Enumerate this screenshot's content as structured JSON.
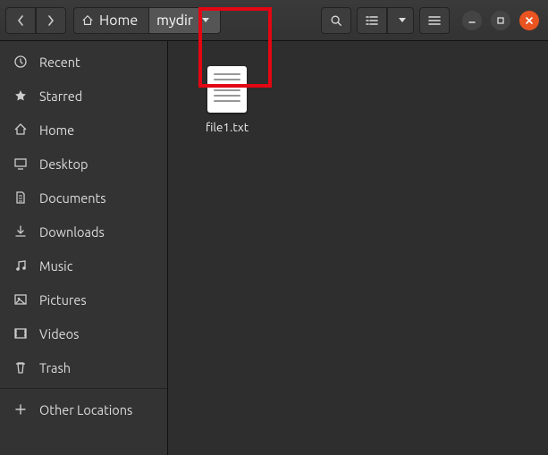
{
  "path": {
    "home_label": "Home",
    "current_label": "mydir"
  },
  "sidebar": {
    "items": [
      {
        "label": "Recent"
      },
      {
        "label": "Starred"
      },
      {
        "label": "Home"
      },
      {
        "label": "Desktop"
      },
      {
        "label": "Documents"
      },
      {
        "label": "Downloads"
      },
      {
        "label": "Music"
      },
      {
        "label": "Pictures"
      },
      {
        "label": "Videos"
      },
      {
        "label": "Trash"
      }
    ],
    "other_label": "Other Locations"
  },
  "content": {
    "files": [
      {
        "name": "file1.txt"
      }
    ]
  }
}
